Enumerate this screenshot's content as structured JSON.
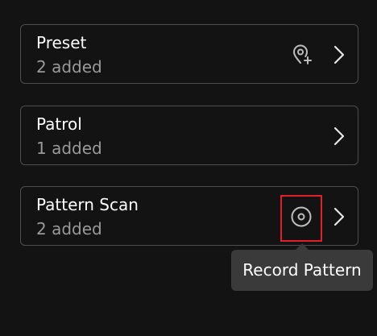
{
  "items": [
    {
      "title": "Preset",
      "subtitle": "2 added",
      "action_icon": "location-pin-add-icon"
    },
    {
      "title": "Patrol",
      "subtitle": "1 added",
      "action_icon": null
    },
    {
      "title": "Pattern Scan",
      "subtitle": "2 added",
      "action_icon": "record-circle-icon"
    }
  ],
  "tooltip": {
    "text": "Record Pattern"
  },
  "colors": {
    "background": "#131313",
    "card_border": "#4d4d4d",
    "subtitle": "#9a9a9a",
    "icon": "#bdbdbd",
    "highlight": "#e01f28",
    "tooltip_bg": "#3a3a3a"
  }
}
